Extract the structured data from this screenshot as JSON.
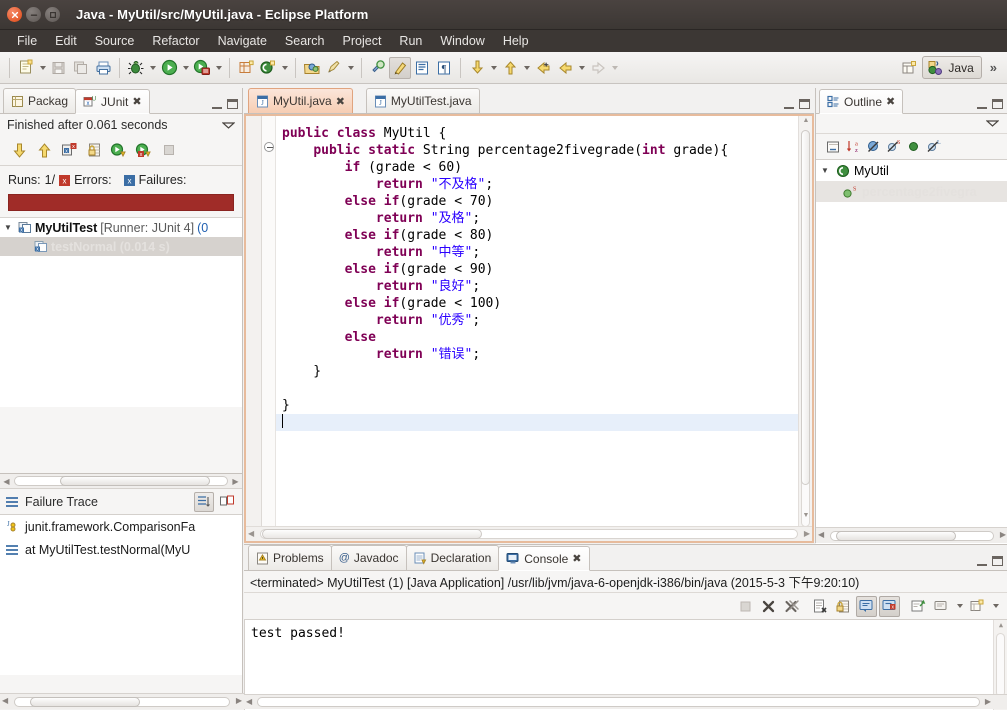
{
  "window": {
    "title": "Java - MyUtil/src/MyUtil.java - Eclipse Platform",
    "close_label": "×",
    "minimize_label": "–",
    "maximize_label": "□"
  },
  "menubar": {
    "items": [
      {
        "label": "File"
      },
      {
        "label": "Edit"
      },
      {
        "label": "Source"
      },
      {
        "label": "Refactor"
      },
      {
        "label": "Navigate"
      },
      {
        "label": "Search"
      },
      {
        "label": "Project"
      },
      {
        "label": "Run"
      },
      {
        "label": "Window"
      },
      {
        "label": "Help"
      }
    ]
  },
  "toolbar": {
    "perspective_label": "Java",
    "overflow_label": "»",
    "buttons": [
      {
        "name": "new-wizard",
        "tooltip": "New"
      },
      {
        "name": "save",
        "tooltip": "Save"
      },
      {
        "name": "save-all",
        "tooltip": "Save All"
      },
      {
        "name": "print",
        "tooltip": "Print"
      },
      {
        "name": "debug",
        "tooltip": "Debug"
      },
      {
        "name": "run",
        "tooltip": "Run"
      },
      {
        "name": "external-tools",
        "tooltip": "External Tools"
      },
      {
        "name": "new-java-project",
        "tooltip": "New Java Project"
      },
      {
        "name": "new-java-class",
        "tooltip": "New Java Class"
      },
      {
        "name": "open-type",
        "tooltip": "Open Type"
      },
      {
        "name": "search",
        "tooltip": "Search"
      },
      {
        "name": "next-annotation",
        "tooltip": "Next Annotation"
      },
      {
        "name": "previous-annotation",
        "tooltip": "Previous Annotation"
      },
      {
        "name": "last-edit-location",
        "tooltip": "Last Edit Location"
      },
      {
        "name": "back",
        "tooltip": "Back"
      },
      {
        "name": "forward",
        "tooltip": "Forward"
      },
      {
        "name": "open-perspective",
        "tooltip": "Open Perspective"
      }
    ]
  },
  "junit_view": {
    "tabs": [
      {
        "label": "Packag",
        "selected": false,
        "icon": "package-explorer-icon"
      },
      {
        "label": "JUnit",
        "selected": true,
        "icon": "junit-icon",
        "closeable": true
      }
    ],
    "status_text": "Finished after 0.061 seconds",
    "runs_label": "Runs:",
    "runs_value": "1/",
    "errors_label": "Errors:",
    "errors_value": "",
    "failures_label": "Failures:",
    "failures_value": "",
    "progress_color": "#a02c28",
    "tree": [
      {
        "label": "MyUtilTest",
        "suffix": " [Runner: JUnit 4] ",
        "extra": "(0",
        "expanded": true,
        "selected": false,
        "depth": 0
      },
      {
        "label": "testNormal (0.014 s)",
        "suffix": "",
        "extra": "",
        "expanded": false,
        "selected": true,
        "depth": 1
      }
    ]
  },
  "failure_trace": {
    "title": "Failure Trace",
    "rows": [
      {
        "label": "junit.framework.ComparisonFa",
        "icon": "junit-exception-icon"
      },
      {
        "label": "at MyUtilTest.testNormal(MyU",
        "icon": "stack-frame-icon"
      }
    ],
    "buttons": [
      {
        "name": "filter-stack-trace-button"
      },
      {
        "name": "compare-results-button"
      }
    ]
  },
  "editor": {
    "tabs": [
      {
        "label": "MyUtil.java",
        "selected": true,
        "closeable": true,
        "icon": "java-file-icon"
      },
      {
        "label": "MyUtilTest.java",
        "selected": false,
        "closeable": false,
        "icon": "java-file-icon"
      }
    ],
    "code_lines": [
      [
        {
          "t": "public ",
          "c": "kw"
        },
        {
          "t": "class ",
          "c": "kw"
        },
        {
          "t": "MyUtil {",
          "c": ""
        }
      ],
      [
        {
          "t": "    ",
          "c": ""
        },
        {
          "t": "public static ",
          "c": "kw"
        },
        {
          "t": "String percentage2fivegrade(",
          "c": ""
        },
        {
          "t": "int",
          "c": "kw"
        },
        {
          "t": " grade){",
          "c": ""
        }
      ],
      [
        {
          "t": "        ",
          "c": ""
        },
        {
          "t": "if",
          "c": "kw"
        },
        {
          "t": " (grade < 60)",
          "c": ""
        }
      ],
      [
        {
          "t": "            ",
          "c": ""
        },
        {
          "t": "return",
          "c": "kw"
        },
        {
          "t": " ",
          "c": ""
        },
        {
          "t": "\"不及格\"",
          "c": "str"
        },
        {
          "t": ";",
          "c": ""
        }
      ],
      [
        {
          "t": "        ",
          "c": ""
        },
        {
          "t": "else if",
          "c": "kw"
        },
        {
          "t": "(grade < 70)",
          "c": ""
        }
      ],
      [
        {
          "t": "            ",
          "c": ""
        },
        {
          "t": "return",
          "c": "kw"
        },
        {
          "t": " ",
          "c": ""
        },
        {
          "t": "\"及格\"",
          "c": "str"
        },
        {
          "t": ";",
          "c": ""
        }
      ],
      [
        {
          "t": "        ",
          "c": ""
        },
        {
          "t": "else if",
          "c": "kw"
        },
        {
          "t": "(grade < 80)",
          "c": ""
        }
      ],
      [
        {
          "t": "            ",
          "c": ""
        },
        {
          "t": "return",
          "c": "kw"
        },
        {
          "t": " ",
          "c": ""
        },
        {
          "t": "\"中等\"",
          "c": "str"
        },
        {
          "t": ";",
          "c": ""
        }
      ],
      [
        {
          "t": "        ",
          "c": ""
        },
        {
          "t": "else if",
          "c": "kw"
        },
        {
          "t": "(grade < 90)",
          "c": ""
        }
      ],
      [
        {
          "t": "            ",
          "c": ""
        },
        {
          "t": "return",
          "c": "kw"
        },
        {
          "t": " ",
          "c": ""
        },
        {
          "t": "\"良好\"",
          "c": "str"
        },
        {
          "t": ";",
          "c": ""
        }
      ],
      [
        {
          "t": "        ",
          "c": ""
        },
        {
          "t": "else if",
          "c": "kw"
        },
        {
          "t": "(grade < 100)",
          "c": ""
        }
      ],
      [
        {
          "t": "            ",
          "c": ""
        },
        {
          "t": "return",
          "c": "kw"
        },
        {
          "t": " ",
          "c": ""
        },
        {
          "t": "\"优秀\"",
          "c": "str"
        },
        {
          "t": ";",
          "c": ""
        }
      ],
      [
        {
          "t": "        ",
          "c": ""
        },
        {
          "t": "else",
          "c": "kw"
        }
      ],
      [
        {
          "t": "            ",
          "c": ""
        },
        {
          "t": "return",
          "c": "kw"
        },
        {
          "t": " ",
          "c": ""
        },
        {
          "t": "\"错误\"",
          "c": "str"
        },
        {
          "t": ";",
          "c": ""
        }
      ],
      [
        {
          "t": "    }",
          "c": ""
        }
      ],
      [
        {
          "t": "",
          "c": ""
        }
      ],
      [
        {
          "t": "}",
          "c": ""
        }
      ],
      [
        {
          "t": "",
          "c": ""
        }
      ]
    ],
    "cursor_line_index": 17
  },
  "outline": {
    "tabs": [
      {
        "label": "Outline",
        "selected": true,
        "closeable": true,
        "icon": "outline-icon"
      }
    ],
    "toolbar_buttons": [
      {
        "name": "collapse-all-button"
      },
      {
        "name": "sort-button"
      },
      {
        "name": "hide-fields-button"
      },
      {
        "name": "hide-static-button"
      },
      {
        "name": "hide-non-public-button"
      },
      {
        "name": "hide-local-types-button"
      }
    ],
    "tree": [
      {
        "label": "MyUtil",
        "depth": 0,
        "selected": false,
        "icon": "java-class-icon"
      },
      {
        "label": "percentage2fivegra",
        "depth": 1,
        "selected": true,
        "icon": "public-static-method-icon"
      }
    ]
  },
  "console": {
    "tabs": [
      {
        "label": "Problems",
        "selected": false,
        "icon": "problems-icon"
      },
      {
        "label": "Javadoc",
        "selected": false,
        "icon": "javadoc-icon"
      },
      {
        "label": "Declaration",
        "selected": false,
        "icon": "declaration-icon"
      },
      {
        "label": "Console",
        "selected": true,
        "icon": "console-icon",
        "closeable": true
      }
    ],
    "description": "<terminated> MyUtilTest (1) [Java Application] /usr/lib/jvm/java-6-openjdk-i386/bin/java (2015-5-3 下午9:20:10)",
    "output": "test passed!",
    "toolbar_buttons": [
      {
        "name": "terminate-button",
        "enabled": false
      },
      {
        "name": "remove-launch-button",
        "enabled": true
      },
      {
        "name": "remove-all-terminated-button",
        "enabled": true
      },
      {
        "name": "clear-console-button",
        "enabled": true
      },
      {
        "name": "scroll-lock-button",
        "enabled": true
      },
      {
        "name": "show-console-on-output-button",
        "enabled": true,
        "toggled": true
      },
      {
        "name": "show-console-on-error-button",
        "enabled": true,
        "toggled": true
      },
      {
        "name": "pin-console-button",
        "enabled": true
      },
      {
        "name": "display-selected-console-button",
        "enabled": true
      },
      {
        "name": "open-console-button",
        "enabled": true
      }
    ]
  },
  "colors": {
    "keyword": "#7f0055",
    "string": "#2a00ff",
    "editor_border": "#e7bb9c",
    "selection": "#d6d2ce",
    "progress_fail": "#a02c28",
    "link": "#1f5fb0"
  }
}
